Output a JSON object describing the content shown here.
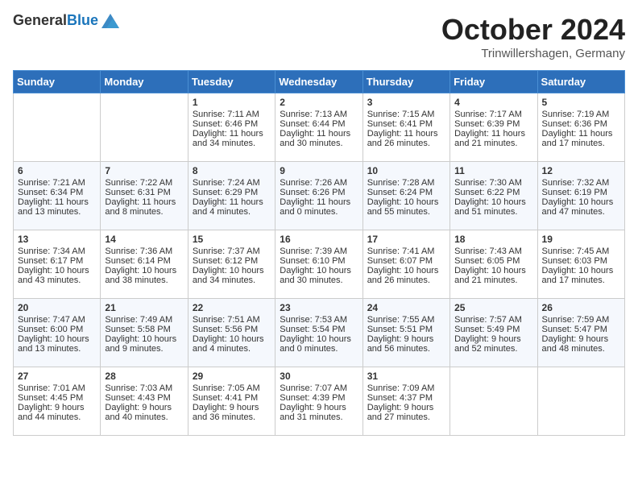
{
  "header": {
    "logo_line1": "General",
    "logo_line2": "Blue",
    "month": "October 2024",
    "location": "Trinwillershagen, Germany"
  },
  "days_of_week": [
    "Sunday",
    "Monday",
    "Tuesday",
    "Wednesday",
    "Thursday",
    "Friday",
    "Saturday"
  ],
  "weeks": [
    [
      {
        "day": "",
        "sunrise": "",
        "sunset": "",
        "daylight": ""
      },
      {
        "day": "",
        "sunrise": "",
        "sunset": "",
        "daylight": ""
      },
      {
        "day": "1",
        "sunrise": "Sunrise: 7:11 AM",
        "sunset": "Sunset: 6:46 PM",
        "daylight": "Daylight: 11 hours and 34 minutes."
      },
      {
        "day": "2",
        "sunrise": "Sunrise: 7:13 AM",
        "sunset": "Sunset: 6:44 PM",
        "daylight": "Daylight: 11 hours and 30 minutes."
      },
      {
        "day": "3",
        "sunrise": "Sunrise: 7:15 AM",
        "sunset": "Sunset: 6:41 PM",
        "daylight": "Daylight: 11 hours and 26 minutes."
      },
      {
        "day": "4",
        "sunrise": "Sunrise: 7:17 AM",
        "sunset": "Sunset: 6:39 PM",
        "daylight": "Daylight: 11 hours and 21 minutes."
      },
      {
        "day": "5",
        "sunrise": "Sunrise: 7:19 AM",
        "sunset": "Sunset: 6:36 PM",
        "daylight": "Daylight: 11 hours and 17 minutes."
      }
    ],
    [
      {
        "day": "6",
        "sunrise": "Sunrise: 7:21 AM",
        "sunset": "Sunset: 6:34 PM",
        "daylight": "Daylight: 11 hours and 13 minutes."
      },
      {
        "day": "7",
        "sunrise": "Sunrise: 7:22 AM",
        "sunset": "Sunset: 6:31 PM",
        "daylight": "Daylight: 11 hours and 8 minutes."
      },
      {
        "day": "8",
        "sunrise": "Sunrise: 7:24 AM",
        "sunset": "Sunset: 6:29 PM",
        "daylight": "Daylight: 11 hours and 4 minutes."
      },
      {
        "day": "9",
        "sunrise": "Sunrise: 7:26 AM",
        "sunset": "Sunset: 6:26 PM",
        "daylight": "Daylight: 11 hours and 0 minutes."
      },
      {
        "day": "10",
        "sunrise": "Sunrise: 7:28 AM",
        "sunset": "Sunset: 6:24 PM",
        "daylight": "Daylight: 10 hours and 55 minutes."
      },
      {
        "day": "11",
        "sunrise": "Sunrise: 7:30 AM",
        "sunset": "Sunset: 6:22 PM",
        "daylight": "Daylight: 10 hours and 51 minutes."
      },
      {
        "day": "12",
        "sunrise": "Sunrise: 7:32 AM",
        "sunset": "Sunset: 6:19 PM",
        "daylight": "Daylight: 10 hours and 47 minutes."
      }
    ],
    [
      {
        "day": "13",
        "sunrise": "Sunrise: 7:34 AM",
        "sunset": "Sunset: 6:17 PM",
        "daylight": "Daylight: 10 hours and 43 minutes."
      },
      {
        "day": "14",
        "sunrise": "Sunrise: 7:36 AM",
        "sunset": "Sunset: 6:14 PM",
        "daylight": "Daylight: 10 hours and 38 minutes."
      },
      {
        "day": "15",
        "sunrise": "Sunrise: 7:37 AM",
        "sunset": "Sunset: 6:12 PM",
        "daylight": "Daylight: 10 hours and 34 minutes."
      },
      {
        "day": "16",
        "sunrise": "Sunrise: 7:39 AM",
        "sunset": "Sunset: 6:10 PM",
        "daylight": "Daylight: 10 hours and 30 minutes."
      },
      {
        "day": "17",
        "sunrise": "Sunrise: 7:41 AM",
        "sunset": "Sunset: 6:07 PM",
        "daylight": "Daylight: 10 hours and 26 minutes."
      },
      {
        "day": "18",
        "sunrise": "Sunrise: 7:43 AM",
        "sunset": "Sunset: 6:05 PM",
        "daylight": "Daylight: 10 hours and 21 minutes."
      },
      {
        "day": "19",
        "sunrise": "Sunrise: 7:45 AM",
        "sunset": "Sunset: 6:03 PM",
        "daylight": "Daylight: 10 hours and 17 minutes."
      }
    ],
    [
      {
        "day": "20",
        "sunrise": "Sunrise: 7:47 AM",
        "sunset": "Sunset: 6:00 PM",
        "daylight": "Daylight: 10 hours and 13 minutes."
      },
      {
        "day": "21",
        "sunrise": "Sunrise: 7:49 AM",
        "sunset": "Sunset: 5:58 PM",
        "daylight": "Daylight: 10 hours and 9 minutes."
      },
      {
        "day": "22",
        "sunrise": "Sunrise: 7:51 AM",
        "sunset": "Sunset: 5:56 PM",
        "daylight": "Daylight: 10 hours and 4 minutes."
      },
      {
        "day": "23",
        "sunrise": "Sunrise: 7:53 AM",
        "sunset": "Sunset: 5:54 PM",
        "daylight": "Daylight: 10 hours and 0 minutes."
      },
      {
        "day": "24",
        "sunrise": "Sunrise: 7:55 AM",
        "sunset": "Sunset: 5:51 PM",
        "daylight": "Daylight: 9 hours and 56 minutes."
      },
      {
        "day": "25",
        "sunrise": "Sunrise: 7:57 AM",
        "sunset": "Sunset: 5:49 PM",
        "daylight": "Daylight: 9 hours and 52 minutes."
      },
      {
        "day": "26",
        "sunrise": "Sunrise: 7:59 AM",
        "sunset": "Sunset: 5:47 PM",
        "daylight": "Daylight: 9 hours and 48 minutes."
      }
    ],
    [
      {
        "day": "27",
        "sunrise": "Sunrise: 7:01 AM",
        "sunset": "Sunset: 4:45 PM",
        "daylight": "Daylight: 9 hours and 44 minutes."
      },
      {
        "day": "28",
        "sunrise": "Sunrise: 7:03 AM",
        "sunset": "Sunset: 4:43 PM",
        "daylight": "Daylight: 9 hours and 40 minutes."
      },
      {
        "day": "29",
        "sunrise": "Sunrise: 7:05 AM",
        "sunset": "Sunset: 4:41 PM",
        "daylight": "Daylight: 9 hours and 36 minutes."
      },
      {
        "day": "30",
        "sunrise": "Sunrise: 7:07 AM",
        "sunset": "Sunset: 4:39 PM",
        "daylight": "Daylight: 9 hours and 31 minutes."
      },
      {
        "day": "31",
        "sunrise": "Sunrise: 7:09 AM",
        "sunset": "Sunset: 4:37 PM",
        "daylight": "Daylight: 9 hours and 27 minutes."
      },
      {
        "day": "",
        "sunrise": "",
        "sunset": "",
        "daylight": ""
      },
      {
        "day": "",
        "sunrise": "",
        "sunset": "",
        "daylight": ""
      }
    ]
  ]
}
